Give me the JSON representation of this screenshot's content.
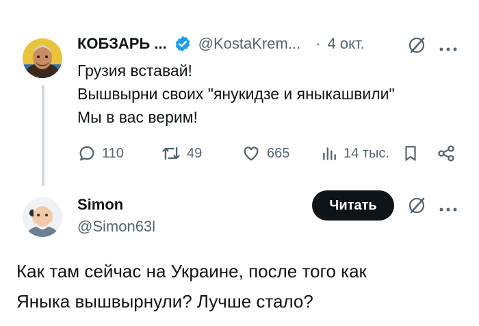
{
  "tweet1": {
    "author_name": "КОБЗАРЬ ...",
    "author_handle": "@KostaKrem...",
    "separator": "·",
    "date": "4 окт.",
    "text_lines": [
      "Грузия вставай!",
      "Вышвырни своих \"янукидзе и яныкашвили\"",
      "Мы в вас верим!"
    ],
    "stats": {
      "replies": "110",
      "retweets": "49",
      "likes": "665",
      "views": "14 тыс."
    },
    "icons": [
      "verified-badge-icon",
      "grok-icon",
      "more-icon",
      "reply-icon",
      "retweet-icon",
      "like-icon",
      "views-icon",
      "bookmark-icon",
      "share-icon"
    ],
    "colors": {
      "verified": "#1d9bf0"
    }
  },
  "tweet2": {
    "author_name": "Simon",
    "author_handle": "@Simon63l",
    "read_button_label": "Читать",
    "text_lines": [
      "Как там сейчас на Украине, после того как",
      "Яныка вышвырнули? Лучше стало?"
    ]
  }
}
